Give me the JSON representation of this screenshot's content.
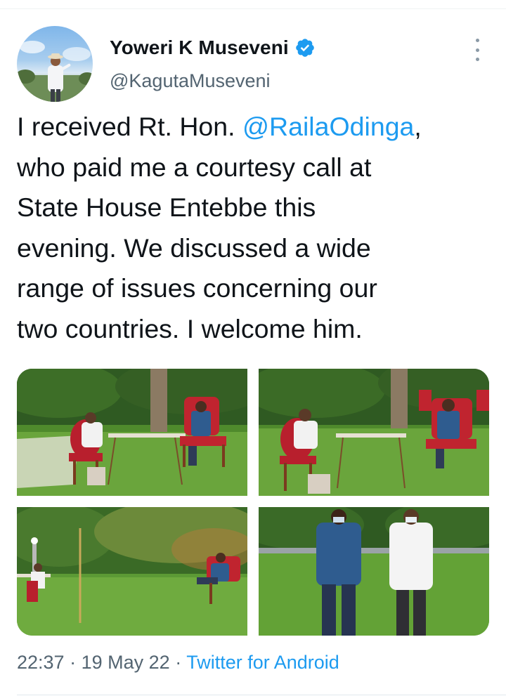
{
  "tweet": {
    "author_name": "Yoweri K Museveni",
    "author_handle": "@KagutaMuseveni",
    "text_lines": [
      {
        "before": "I received Rt. Hon. ",
        "mention": "@RailaOdinga",
        "after": ","
      },
      {
        "text": "who paid me a courtesy call at"
      },
      {
        "text": "State House Entebbe this"
      },
      {
        "text": "evening. We discussed a wide"
      },
      {
        "text": "range of issues concerning our"
      },
      {
        "text": "two countries. I welcome him."
      }
    ],
    "time": "22:37",
    "separator": "·",
    "date": "19 May 22",
    "source": "Twitter for Android"
  },
  "icons": {
    "verified": "verified-badge-icon",
    "more": "more-options-icon"
  },
  "colors": {
    "link": "#1d9bf0",
    "secondary_text": "#536471",
    "primary_text": "#0f1419"
  }
}
